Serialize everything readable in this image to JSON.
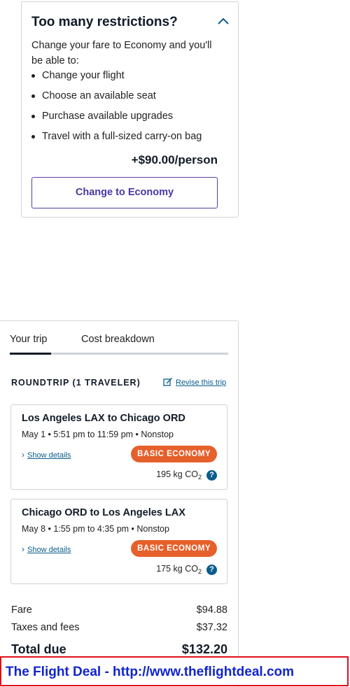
{
  "restrictions": {
    "title": "Too many restrictions?",
    "intro": "Change your fare to Economy and you'll be able to:",
    "items": [
      "Change your flight",
      "Choose an available seat",
      "Purchase available upgrades",
      "Travel with a full-sized carry-on bag"
    ],
    "price": "+$90.00/person",
    "button_label": "Change to Economy"
  },
  "tabs": {
    "trip": "Your trip",
    "cost": "Cost breakdown",
    "active": "trip"
  },
  "trip": {
    "heading": "ROUNDTRIP (1 TRAVELER)",
    "revise_label": "Revise this trip",
    "segments": [
      {
        "route": "Los Angeles LAX to Chicago ORD",
        "time": "May 1 • 5:51 pm to 11:59 pm • Nonstop",
        "details": "Show details",
        "fare_badge": "BASIC ECONOMY",
        "co2_value": "195 kg CO",
        "co2_sub": "2"
      },
      {
        "route": "Chicago ORD to Los Angeles LAX",
        "time": "May 8 • 1:55 pm to 4:35 pm • Nonstop",
        "details": "Show details",
        "fare_badge": "BASIC ECONOMY",
        "co2_value": "175 kg CO",
        "co2_sub": "2"
      }
    ]
  },
  "costs": {
    "fare_label": "Fare",
    "fare_amount": "$94.88",
    "taxes_label": "Taxes and fees",
    "taxes_amount": "$37.32",
    "total_label": "Total due",
    "total_amount": "$132.20"
  },
  "watermark": {
    "text": "The Flight Deal - http://www.theflightdeal.com"
  },
  "colors": {
    "accent_purple": "#4a36a6",
    "link_blue": "#0a5d8c",
    "badge_orange": "#e5602b",
    "banner_border": "#e0101a",
    "banner_text": "#1024d0"
  }
}
